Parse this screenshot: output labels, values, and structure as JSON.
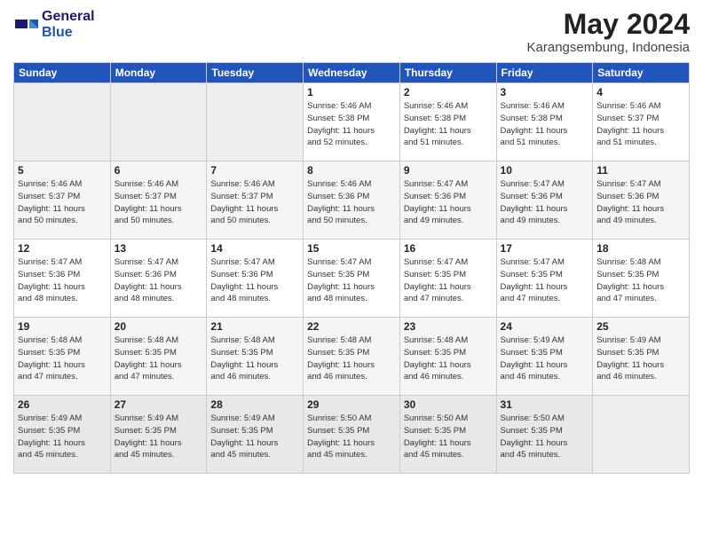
{
  "header": {
    "logo_line1": "General",
    "logo_line2": "Blue",
    "month": "May 2024",
    "location": "Karangsembung, Indonesia"
  },
  "weekdays": [
    "Sunday",
    "Monday",
    "Tuesday",
    "Wednesday",
    "Thursday",
    "Friday",
    "Saturday"
  ],
  "weeks": [
    [
      {
        "day": "",
        "info": ""
      },
      {
        "day": "",
        "info": ""
      },
      {
        "day": "",
        "info": ""
      },
      {
        "day": "1",
        "info": "Sunrise: 5:46 AM\nSunset: 5:38 PM\nDaylight: 11 hours\nand 52 minutes."
      },
      {
        "day": "2",
        "info": "Sunrise: 5:46 AM\nSunset: 5:38 PM\nDaylight: 11 hours\nand 51 minutes."
      },
      {
        "day": "3",
        "info": "Sunrise: 5:46 AM\nSunset: 5:38 PM\nDaylight: 11 hours\nand 51 minutes."
      },
      {
        "day": "4",
        "info": "Sunrise: 5:46 AM\nSunset: 5:37 PM\nDaylight: 11 hours\nand 51 minutes."
      }
    ],
    [
      {
        "day": "5",
        "info": "Sunrise: 5:46 AM\nSunset: 5:37 PM\nDaylight: 11 hours\nand 50 minutes."
      },
      {
        "day": "6",
        "info": "Sunrise: 5:46 AM\nSunset: 5:37 PM\nDaylight: 11 hours\nand 50 minutes."
      },
      {
        "day": "7",
        "info": "Sunrise: 5:46 AM\nSunset: 5:37 PM\nDaylight: 11 hours\nand 50 minutes."
      },
      {
        "day": "8",
        "info": "Sunrise: 5:46 AM\nSunset: 5:36 PM\nDaylight: 11 hours\nand 50 minutes."
      },
      {
        "day": "9",
        "info": "Sunrise: 5:47 AM\nSunset: 5:36 PM\nDaylight: 11 hours\nand 49 minutes."
      },
      {
        "day": "10",
        "info": "Sunrise: 5:47 AM\nSunset: 5:36 PM\nDaylight: 11 hours\nand 49 minutes."
      },
      {
        "day": "11",
        "info": "Sunrise: 5:47 AM\nSunset: 5:36 PM\nDaylight: 11 hours\nand 49 minutes."
      }
    ],
    [
      {
        "day": "12",
        "info": "Sunrise: 5:47 AM\nSunset: 5:36 PM\nDaylight: 11 hours\nand 48 minutes."
      },
      {
        "day": "13",
        "info": "Sunrise: 5:47 AM\nSunset: 5:36 PM\nDaylight: 11 hours\nand 48 minutes."
      },
      {
        "day": "14",
        "info": "Sunrise: 5:47 AM\nSunset: 5:36 PM\nDaylight: 11 hours\nand 48 minutes."
      },
      {
        "day": "15",
        "info": "Sunrise: 5:47 AM\nSunset: 5:35 PM\nDaylight: 11 hours\nand 48 minutes."
      },
      {
        "day": "16",
        "info": "Sunrise: 5:47 AM\nSunset: 5:35 PM\nDaylight: 11 hours\nand 47 minutes."
      },
      {
        "day": "17",
        "info": "Sunrise: 5:47 AM\nSunset: 5:35 PM\nDaylight: 11 hours\nand 47 minutes."
      },
      {
        "day": "18",
        "info": "Sunrise: 5:48 AM\nSunset: 5:35 PM\nDaylight: 11 hours\nand 47 minutes."
      }
    ],
    [
      {
        "day": "19",
        "info": "Sunrise: 5:48 AM\nSunset: 5:35 PM\nDaylight: 11 hours\nand 47 minutes."
      },
      {
        "day": "20",
        "info": "Sunrise: 5:48 AM\nSunset: 5:35 PM\nDaylight: 11 hours\nand 47 minutes."
      },
      {
        "day": "21",
        "info": "Sunrise: 5:48 AM\nSunset: 5:35 PM\nDaylight: 11 hours\nand 46 minutes."
      },
      {
        "day": "22",
        "info": "Sunrise: 5:48 AM\nSunset: 5:35 PM\nDaylight: 11 hours\nand 46 minutes."
      },
      {
        "day": "23",
        "info": "Sunrise: 5:48 AM\nSunset: 5:35 PM\nDaylight: 11 hours\nand 46 minutes."
      },
      {
        "day": "24",
        "info": "Sunrise: 5:49 AM\nSunset: 5:35 PM\nDaylight: 11 hours\nand 46 minutes."
      },
      {
        "day": "25",
        "info": "Sunrise: 5:49 AM\nSunset: 5:35 PM\nDaylight: 11 hours\nand 46 minutes."
      }
    ],
    [
      {
        "day": "26",
        "info": "Sunrise: 5:49 AM\nSunset: 5:35 PM\nDaylight: 11 hours\nand 45 minutes."
      },
      {
        "day": "27",
        "info": "Sunrise: 5:49 AM\nSunset: 5:35 PM\nDaylight: 11 hours\nand 45 minutes."
      },
      {
        "day": "28",
        "info": "Sunrise: 5:49 AM\nSunset: 5:35 PM\nDaylight: 11 hours\nand 45 minutes."
      },
      {
        "day": "29",
        "info": "Sunrise: 5:50 AM\nSunset: 5:35 PM\nDaylight: 11 hours\nand 45 minutes."
      },
      {
        "day": "30",
        "info": "Sunrise: 5:50 AM\nSunset: 5:35 PM\nDaylight: 11 hours\nand 45 minutes."
      },
      {
        "day": "31",
        "info": "Sunrise: 5:50 AM\nSunset: 5:35 PM\nDaylight: 11 hours\nand 45 minutes."
      },
      {
        "day": "",
        "info": ""
      }
    ]
  ]
}
